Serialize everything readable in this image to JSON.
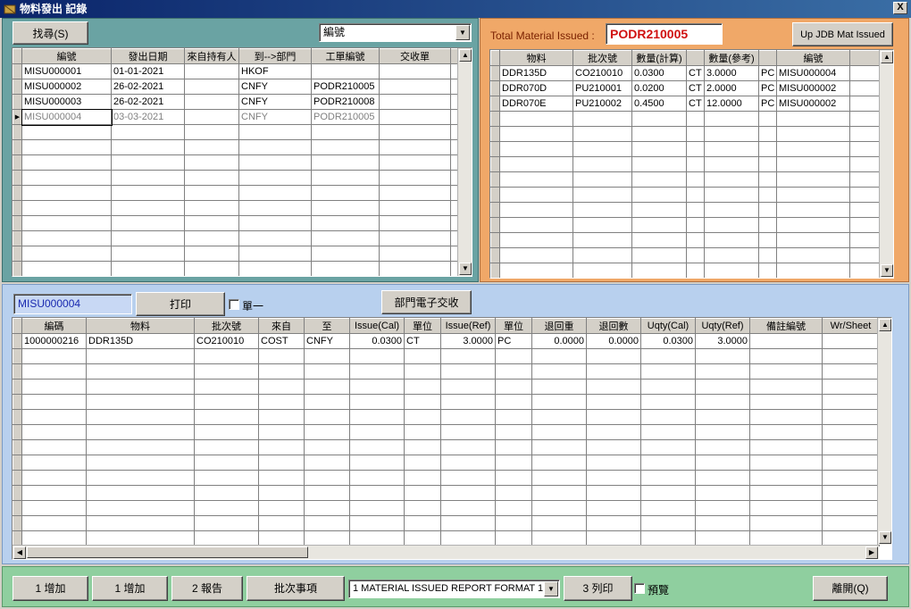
{
  "window": {
    "title": "物料發出 記錄",
    "close": "X"
  },
  "top_left": {
    "find_button": "找尋(S)",
    "sort_select": "編號",
    "columns": [
      "編號",
      "發出日期",
      "來自持有人",
      "到-->部門",
      "工單編號",
      "交收單"
    ],
    "rows": [
      [
        "MISU000001",
        "01-01-2021",
        "",
        "HKOF",
        "",
        ""
      ],
      [
        "MISU000002",
        "26-02-2021",
        "",
        "CNFY",
        "PODR210005",
        ""
      ],
      [
        "MISU000003",
        "26-02-2021",
        "",
        "CNFY",
        "PODR210008",
        ""
      ],
      [
        "MISU000004",
        "03-03-2021",
        "",
        "CNFY",
        "PODR210005",
        ""
      ]
    ]
  },
  "top_right": {
    "total_label": "Total Material Issued :",
    "total_value": "PODR210005",
    "up_button": "Up JDB Mat Issued",
    "columns": [
      "物料",
      "批次號",
      "數量(計算)",
      "",
      "數量(參考)",
      "",
      "編號"
    ],
    "rows": [
      [
        "DDR135D",
        "CO210010",
        "0.0300",
        "CT",
        "3.0000",
        "PC",
        "MISU000004"
      ],
      [
        "DDR070D",
        "PU210001",
        "0.0200",
        "CT",
        "2.0000",
        "PC",
        "MISU000002"
      ],
      [
        "DDR070E",
        "PU210002",
        "0.4500",
        "CT",
        "12.0000",
        "PC",
        "MISU000002"
      ]
    ]
  },
  "middle": {
    "selected_id": "MISU000004",
    "print_button": "打印",
    "single_label": "單一",
    "dept_button": "部門電子交收",
    "columns": [
      "編碼",
      "物料",
      "批次號",
      "來自",
      "至",
      "Issue(Cal)",
      "單位",
      "Issue(Ref)",
      "單位",
      "退回重",
      "退回數",
      "Uqty(Cal)",
      "Uqty(Ref)",
      "備註編號",
      "Wr/Sheet"
    ],
    "rows": [
      [
        "1000000216",
        "DDR135D",
        "CO210010",
        "COST",
        "CNFY",
        "0.0300",
        "CT",
        "3.0000",
        "PC",
        "0.0000",
        "0.0000",
        "0.0300",
        "3.0000",
        "",
        ""
      ]
    ]
  },
  "bottom": {
    "add1": "1 增加",
    "add2": "1 增加",
    "report": "2 報告",
    "batch": "批次事項",
    "report_format": "1 MATERIAL ISSUED REPORT FORMAT 1 -",
    "print_list": "3 列印",
    "preview": "預覽",
    "exit": "離開(Q)"
  }
}
